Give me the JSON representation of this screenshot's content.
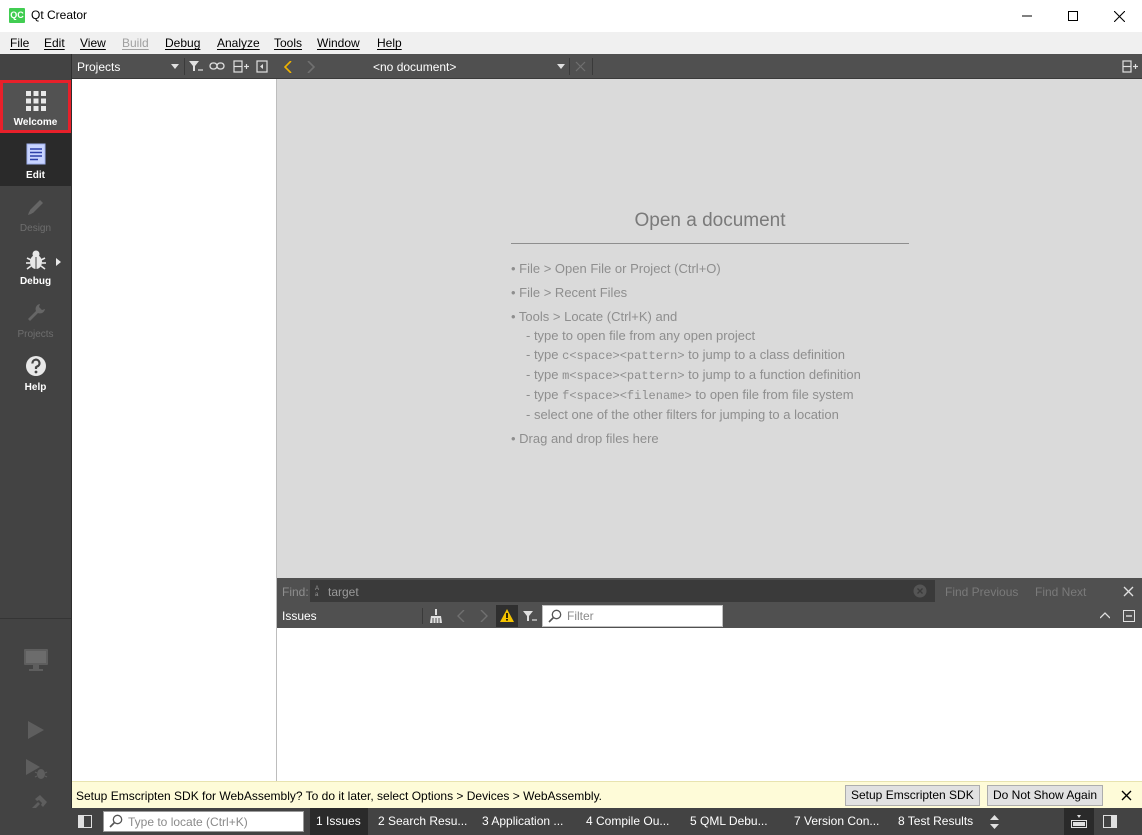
{
  "window": {
    "title": "Qt Creator",
    "logo_text": "QC"
  },
  "menubar": {
    "items": [
      {
        "label": "File",
        "enabled": true
      },
      {
        "label": "Edit",
        "enabled": true
      },
      {
        "label": "View",
        "enabled": true
      },
      {
        "label": "Build",
        "enabled": false
      },
      {
        "label": "Debug",
        "enabled": true
      },
      {
        "label": "Analyze",
        "enabled": true
      },
      {
        "label": "Tools",
        "enabled": true
      },
      {
        "label": "Window",
        "enabled": true
      },
      {
        "label": "Help",
        "enabled": true
      }
    ]
  },
  "modes": [
    {
      "label": "Welcome",
      "icon": "grid-icon",
      "state": "highlighted"
    },
    {
      "label": "Edit",
      "icon": "document-icon",
      "state": "active"
    },
    {
      "label": "Design",
      "icon": "pencil-icon",
      "state": "disabled"
    },
    {
      "label": "Debug",
      "icon": "bug-icon",
      "state": "enabled"
    },
    {
      "label": "Projects",
      "icon": "wrench-icon",
      "state": "disabled"
    },
    {
      "label": "Help",
      "icon": "help-icon",
      "state": "enabled"
    }
  ],
  "projects_pane": {
    "title": "Projects"
  },
  "editor": {
    "document_combo": "<no document>",
    "placeholder": {
      "title": "Open a document",
      "hints": {
        "h1": "• File > Open File or Project (Ctrl+O)",
        "h2": "• File > Recent Files",
        "h3": "• Tools > Locate (Ctrl+K) and",
        "h4": "- type to open file from any open project",
        "h5_pre": "- type ",
        "h5_code": "c<space><pattern>",
        "h5_post": " to jump to a class definition",
        "h6_pre": "- type ",
        "h6_code": "m<space><pattern>",
        "h6_post": " to jump to a function definition",
        "h7_pre": "- type ",
        "h7_code": "f<space><filename>",
        "h7_post": " to open file from file system",
        "h8": "- select one of the other filters for jumping to a location",
        "h9": "• Drag and drop files here"
      }
    }
  },
  "findbar": {
    "label": "Find:",
    "value": "target",
    "find_previous": "Find Previous",
    "find_next": "Find Next"
  },
  "issues": {
    "title": "Issues",
    "filter_placeholder": "Filter"
  },
  "infobar": {
    "message": "Setup Emscripten SDK for WebAssembly? To do it later, select Options > Devices > WebAssembly.",
    "setup_button": "Setup Emscripten SDK",
    "dismiss_button": "Do Not Show Again"
  },
  "statusbar": {
    "locator_placeholder": "Type to locate (Ctrl+K)",
    "output_panes": [
      {
        "label": "1  Issues",
        "active": true
      },
      {
        "label": "2  Search Resu...",
        "active": false
      },
      {
        "label": "3  Application ...",
        "active": false
      },
      {
        "label": "4  Compile Ou...",
        "active": false
      },
      {
        "label": "5  QML Debu...",
        "active": false
      },
      {
        "label": "7  Version Con...",
        "active": false
      },
      {
        "label": "8  Test Results",
        "active": false
      }
    ]
  },
  "colors": {
    "accent_highlight": "#e8202a",
    "qt_green": "#41cd52",
    "sidebar_bg": "#434343",
    "editor_bg": "#dadada",
    "infobar_bg": "#fefbd8",
    "warning_yellow": "#f5c400"
  }
}
